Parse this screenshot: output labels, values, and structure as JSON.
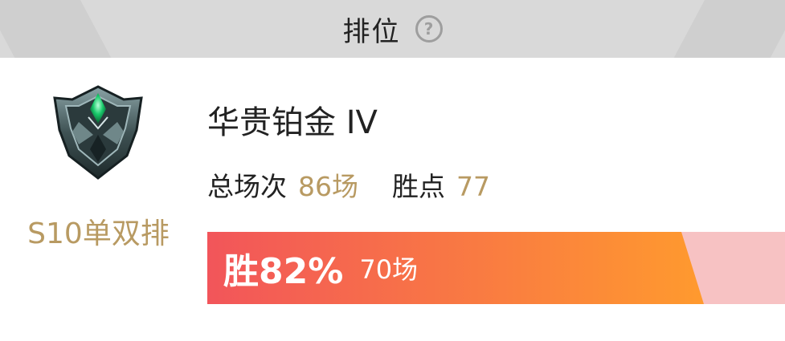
{
  "header": {
    "tab_title": "排位",
    "help_icon": "help-icon",
    "help_glyph": "?"
  },
  "rank": {
    "tier": "华贵铂金 IV",
    "season": "S10单双排",
    "emblem_icon": "platinum-rank-emblem",
    "total_games_label": "总场次",
    "total_games_value": "86场",
    "lp_label": "胜点",
    "lp_value": "77"
  },
  "win_rate": {
    "percent_text": "胜82%",
    "wins_text": "70场",
    "fraction": 0.82,
    "colors": {
      "start": "#f2555a",
      "end": "#ff9a2e",
      "remainder": "#f7c2c3"
    }
  },
  "colors": {
    "accent": "#b89a62",
    "text": "#222222",
    "tabbar": "#d9d9d9"
  }
}
